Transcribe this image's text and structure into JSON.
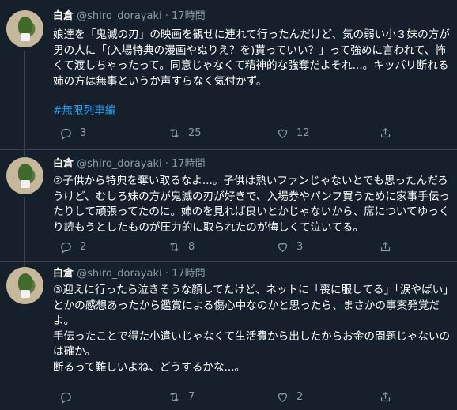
{
  "tweets": [
    {
      "name": "白倉",
      "handle": "@shiro_dorayaki",
      "separator": "·",
      "time": "17時間",
      "text": "娘達を「鬼滅の刃」の映画を観せに連れて行ったんだけど、気の弱い小３妹の方が男の人に「(入場特典の漫画やぬりえ？を)貰っていい？」って強めに言われて、怖くて渡しちゃったって。同意じゃなくて精神的な強奪だよそれ...。キッパリ断れる姉の方は無事というか声すらなく気付かず。",
      "hashtag": "#無限列車編",
      "replies": "3",
      "retweets": "25",
      "likes": "12"
    },
    {
      "name": "白倉",
      "handle": "@shiro_dorayaki",
      "separator": "·",
      "time": "17時間",
      "text": "②子供から特典を奪い取るなよ...。子供は熱いファンじゃないとでも思ったんだろうけど、むしろ妹の方が鬼滅の刃が好きで、入場券やパンフ買うために家事手伝ったりして頑張ってたのに。姉のを見れば良いとかじゃないから、席についてゆっくり読もうとしたものが圧力的に取られたのが悔しくて泣いてる。",
      "replies": "2",
      "retweets": "8",
      "likes": "3"
    },
    {
      "name": "白倉",
      "handle": "@shiro_dorayaki",
      "separator": "·",
      "time": "17時間",
      "text": "③迎えに行ったら泣きそうな顔してたけど、ネットに「喪に服してる」「涙やばい」とかの感想あったから鑑賞による傷心中なのかと思ったら、まさかの事案発覚だよ。\n手伝ったことで得た小遣いじゃなくて生活費から出したからお金の問題じゃないのは確か。\n断るって難しいよね、どうするかな...。",
      "replies": "",
      "retweets": "7",
      "likes": "2"
    }
  ],
  "icons": [
    "avatar",
    "reply-icon",
    "retweet-icon",
    "like-icon",
    "share-icon"
  ]
}
